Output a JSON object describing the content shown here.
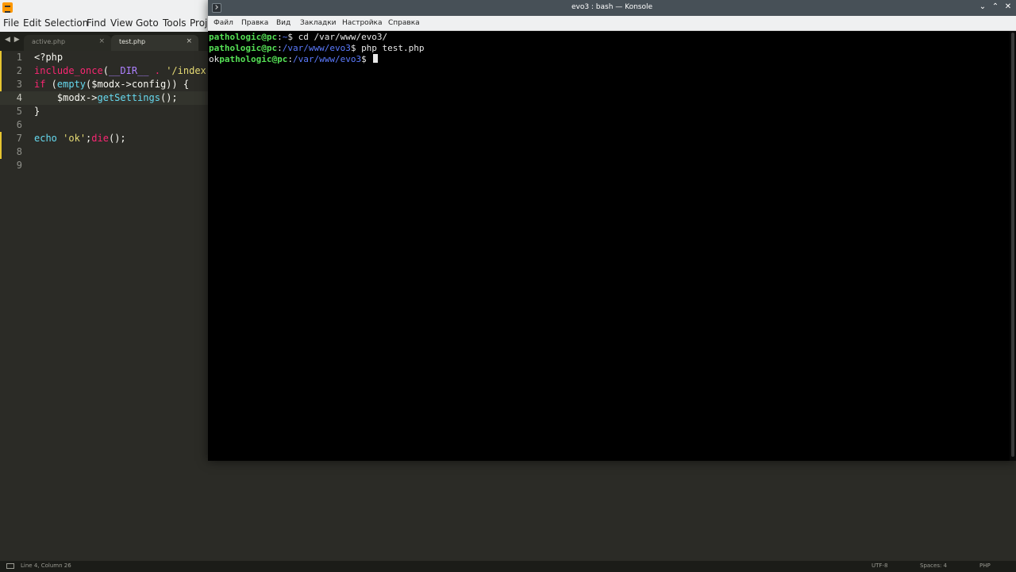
{
  "sublime": {
    "menu": [
      "File",
      "Edit",
      "Selection",
      "Find",
      "View",
      "Goto",
      "Tools",
      "Proje"
    ],
    "tab_nav": "◀ ▶",
    "tabs": [
      {
        "label": "active.php",
        "close": "×",
        "active": false
      },
      {
        "label": "test.php",
        "close": "×",
        "active": true
      }
    ],
    "lines": [
      {
        "num": "1",
        "tokens": [
          {
            "t": "<?php",
            "c": "plain"
          }
        ]
      },
      {
        "num": "2",
        "tokens": [
          {
            "t": "include_once",
            "c": "kw"
          },
          {
            "t": "(",
            "c": "plain"
          },
          {
            "t": "__DIR__",
            "c": "const"
          },
          {
            "t": " . ",
            "c": "kw"
          },
          {
            "t": "'/index",
            "c": "str"
          }
        ]
      },
      {
        "num": "3",
        "tokens": [
          {
            "t": "if",
            "c": "kw"
          },
          {
            "t": " (",
            "c": "plain"
          },
          {
            "t": "empty",
            "c": "fn"
          },
          {
            "t": "($modx->config)) {",
            "c": "plain"
          }
        ]
      },
      {
        "num": "4",
        "tokens": [
          {
            "t": "    $modx->",
            "c": "plain"
          },
          {
            "t": "getSettings",
            "c": "fn"
          },
          {
            "t": "();",
            "c": "plain"
          }
        ]
      },
      {
        "num": "5",
        "tokens": [
          {
            "t": "}",
            "c": "plain"
          }
        ]
      },
      {
        "num": "6",
        "tokens": []
      },
      {
        "num": "7",
        "tokens": [
          {
            "t": "echo",
            "c": "fn"
          },
          {
            "t": " ",
            "c": "plain"
          },
          {
            "t": "'ok'",
            "c": "str"
          },
          {
            "t": ";",
            "c": "plain"
          },
          {
            "t": "die",
            "c": "kw"
          },
          {
            "t": "();",
            "c": "plain"
          }
        ]
      },
      {
        "num": "8",
        "tokens": []
      },
      {
        "num": "9",
        "tokens": []
      }
    ],
    "current_line": 4,
    "status": {
      "position": "Line 4, Column 26",
      "encoding": "UTF-8",
      "indent": "Spaces: 4",
      "syntax": "PHP"
    }
  },
  "konsole": {
    "title": "evo3 : bash — Konsole",
    "wm": {
      "minimize": "⌄",
      "maximize": "⌃",
      "close": "✕"
    },
    "menu": [
      "Файл",
      "Правка",
      "Вид",
      "Закладки",
      "Настройка",
      "Справка"
    ],
    "terminal": [
      {
        "prefix": "",
        "user": "pathologic@pc",
        "sep": ":",
        "path": "~",
        "prompt": "$ ",
        "cmd": "cd /var/www/evo3/"
      },
      {
        "prefix": "",
        "user": "pathologic@pc",
        "sep": ":",
        "path": "/var/www/evo3",
        "prompt": "$ ",
        "cmd": "php test.php"
      },
      {
        "prefix": "ok",
        "user": "pathologic@pc",
        "sep": ":",
        "path": "/var/www/evo3",
        "prompt": "$ ",
        "cmd": ""
      }
    ]
  },
  "colors": {
    "sublime_bg": "#2b2b26",
    "keyword": "#f92672",
    "function": "#66d9ef",
    "string": "#e6db74",
    "constant": "#ae81ff",
    "prompt_user": "#55e055",
    "prompt_path": "#5c7bff"
  }
}
